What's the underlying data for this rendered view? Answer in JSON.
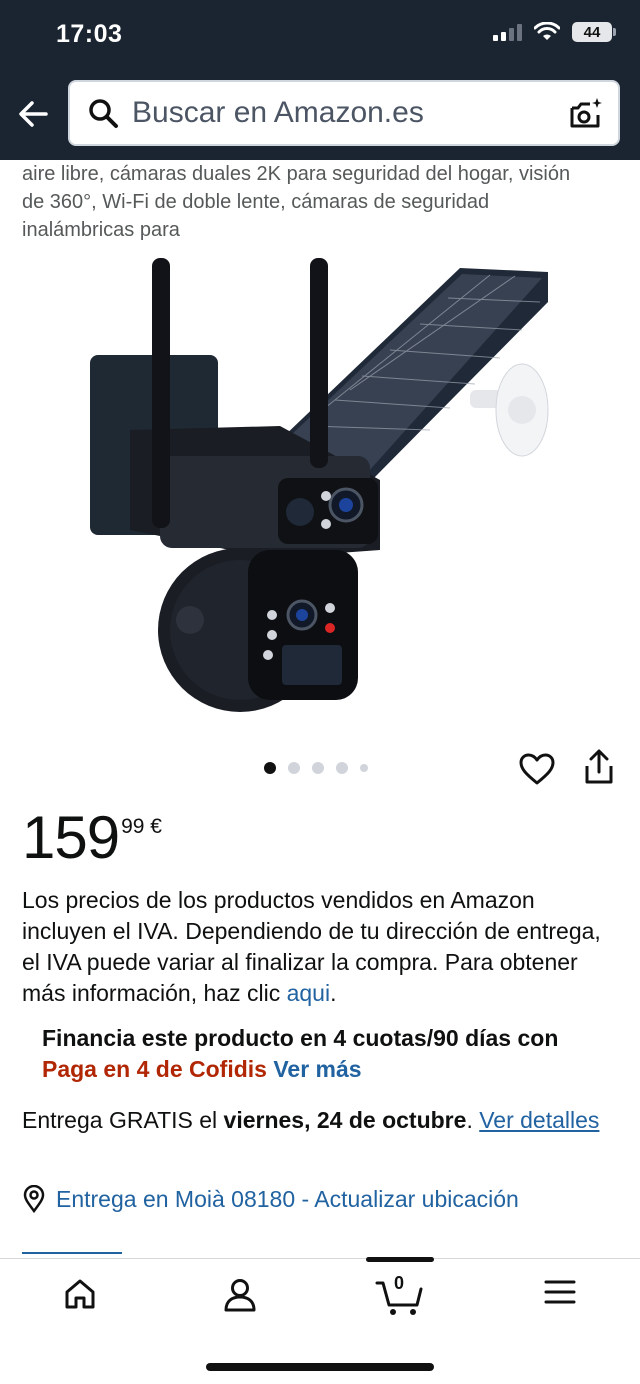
{
  "status": {
    "time": "17:03",
    "battery": "44"
  },
  "header": {
    "search_placeholder": "Buscar en Amazon.es"
  },
  "product": {
    "title_line1": "aire libre, cámaras duales 2K para seguridad del hogar, visión",
    "title_line2": "de 360°, Wi-Fi de doble lente, cámaras de seguridad",
    "title_line3": "inalámbricas para",
    "image_count": 5,
    "active_image": 1
  },
  "price": {
    "whole": "159",
    "fraction": "99 €"
  },
  "vat": {
    "text": "Los precios de los productos vendidos en Amazon incluyen el IVA. Dependiendo de tu dirección de entrega, el IVA puede variar al finalizar la compra. Para obtener más información, haz clic ",
    "link": "aqui",
    "end": "."
  },
  "finance": {
    "text": "Financia este producto en 4 cuotas/90 días con",
    "brand": "Paga en 4 de Cofidis",
    "more": "Ver más"
  },
  "delivery": {
    "prefix": "Entrega GRATIS el ",
    "date": "viernes, 24 de octubre",
    "dot": ". ",
    "link": "Ver detalles"
  },
  "location": {
    "text": "Entrega en Moià 08180 - Actualizar ubicación"
  },
  "nav": {
    "cart_count": "0"
  },
  "colors": {
    "header_bg": "#1b2531",
    "link": "#2162a1",
    "price_accent": "#b12704"
  },
  "icons": [
    "back-arrow-icon",
    "search-icon",
    "camera-lens-icon",
    "heart-icon",
    "share-icon",
    "location-pin-icon",
    "home-icon",
    "user-icon",
    "cart-icon",
    "menu-icon"
  ]
}
